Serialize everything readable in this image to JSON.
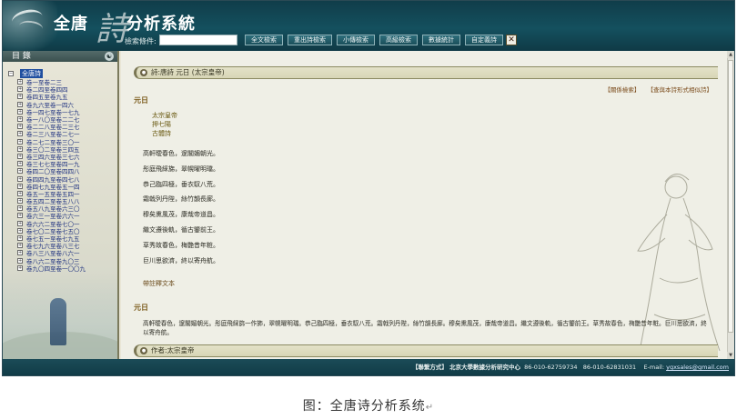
{
  "header": {
    "brand_part1": "全唐",
    "brand_shi": "詩",
    "brand_part2": "分析系統",
    "search_label": "檢索條件:",
    "search_value": "",
    "buttons": [
      "全文檢索",
      "重出詩檢索",
      "小傳檢索",
      "高級檢索",
      "數據統計",
      "自定義詩"
    ],
    "close_label": "✕"
  },
  "sidebar": {
    "title": "目 錄",
    "toggle_icon": "☯",
    "root_label": "全唐詩",
    "items": [
      "卷一至卷二三",
      "卷二四至卷四四",
      "卷四五至卷九五",
      "卷九六至卷一四六",
      "卷一四七至卷一七九",
      "卷一八〇至卷二二七",
      "卷二二八至卷二三七",
      "卷二三八至卷二七一",
      "卷二七二至卷三〇一",
      "卷三〇二至卷三四五",
      "卷三四六至卷三七六",
      "卷三七七至卷四一九",
      "卷四二〇至卷四四八",
      "卷四四九至卷四七八",
      "卷四七九至卷五一四",
      "卷五一五至卷五四一",
      "卷五四二至卷五八八",
      "卷五八九至卷六三〇",
      "卷六三一至卷六六一",
      "卷六六二至卷七〇一",
      "卷七〇二至卷七五〇",
      "卷七五一至卷七九五",
      "卷七九六至卷八三七",
      "卷八三八至卷八六一",
      "卷八六二至卷九〇三",
      "卷九〇四至卷一〇〇九"
    ]
  },
  "main": {
    "poem_bar": "詩:唐詩 元日 (太宗皇帝)",
    "links": [
      "【關係檢索】",
      "【查與本詩形式相似詩】"
    ],
    "title1": "元日",
    "author": "太宗皇帝",
    "rhyme": "押七陽",
    "form": "古體詩",
    "verses": [
      "高軒曖春色，邃閣媚朝光。",
      "彤庭飛綵旆，翠幌曜明璫。",
      "恭己臨四極，垂衣馭八荒。",
      "霜戟列丹陛，絲竹韻長廊。",
      "穆矣熏風茂，康哉帝道昌。",
      "繼文遵後軌，循古鑒前王。",
      "草秀故春色，梅艷昔年粧。",
      "巨川思欲濟，終以寄舟航。"
    ],
    "notes_link": "帶註釋文本",
    "title2": "元日",
    "fulltext": "高軒曖春色，邃閣媚朝光。彤庭飛綵旆一作斾，翠幌曜明璫。恭己臨四極，垂衣馭八荒。霜戟列丹陛，絲竹韻長廊。穆矣熏風茂，康哉帝道昌。繼文遵後軌，循古鑒前王。草秀故春色，梅艷昔年粧。巨川思欲濟，終以寄舟航。",
    "author_bar": "作者:太宗皇帝"
  },
  "footer": {
    "contact_label": "【聯繫方式】",
    "org": "北京大學數據分析研究中心",
    "phone1": "86-010-62759734",
    "phone2": "86-010-62831031",
    "email_label": "E-mail:",
    "email": "ygxsales@gmail.com"
  },
  "caption": {
    "text": "图：全唐诗分析系统",
    "mark": "↵"
  }
}
